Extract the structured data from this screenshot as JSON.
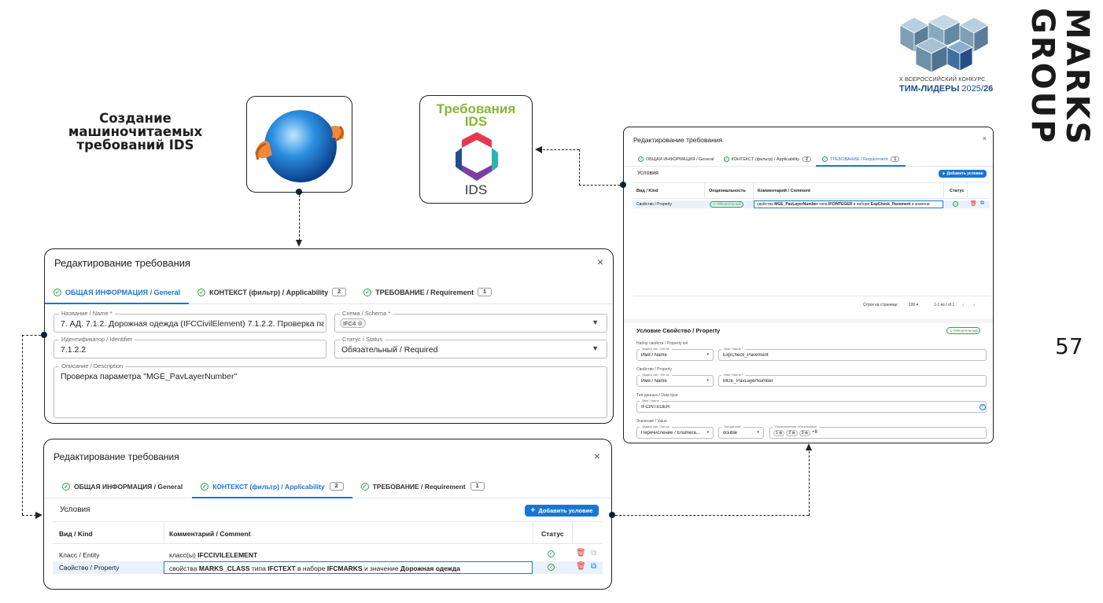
{
  "slide": {
    "title_lines": [
      "Создание",
      "машиночитаемых",
      "требований IDS"
    ],
    "brand": [
      "MARKS",
      "GROUP"
    ],
    "page_number": "57",
    "contest_line1": "X ВСЕРОССИЙСКИЙ КОНКУРС",
    "contest_line2": "ТИМ-ЛИДЕРЫ",
    "contest_year": "2025/",
    "contest_year2": "26",
    "ids_tile_title_1": "Требования",
    "ids_tile_title_2": "IDS",
    "ids_tile_label": "IDS"
  },
  "general_panel": {
    "title": "Редактирование требования",
    "close": "×",
    "tabs": [
      {
        "label": "ОБЩАЯ ИНФОРМАЦИЯ / General",
        "badge": ""
      },
      {
        "label": "КОНТЕКСТ (фильтр) / Applicability",
        "badge": "2"
      },
      {
        "label": "ТРЕБОВАНИЕ / Requirement",
        "badge": "1"
      }
    ],
    "name_label": "Название / Name *",
    "name_value": "7. АД. 7.1.2. Дорожная одежда (IFCCivilElement) 7.1.2.2. Проверка пара",
    "schema_label": "Схема / Schema *",
    "schema_chip": "IFC4",
    "id_label": "Идентификатор / Identifier",
    "id_value": "7.1.2.2",
    "status_label": "Статус / Status",
    "status_value": "Обязательный / Required",
    "desc_label": "Описание / Description",
    "desc_value": "Проверка параметра \"MGE_PavLayerNumber\""
  },
  "context_panel": {
    "title": "Редактирование требования",
    "close": "×",
    "tabs": [
      {
        "label": "ОБЩАЯ ИНФОРМАЦИЯ / General",
        "badge": ""
      },
      {
        "label": "КОНТЕКСТ (фильтр) / Applicability",
        "badge": "2"
      },
      {
        "label": "ТРЕБОВАНИЕ / Requirement",
        "badge": "1"
      }
    ],
    "section": "Условия",
    "add_button": "Добавить условие",
    "columns": [
      "Вид / Kind",
      "Комментарий / Comment",
      "Статус"
    ],
    "rows": [
      {
        "kind": "Класс / Entity",
        "c1": "класс(ы) ",
        "b1": "IFCCIVILELEMENT",
        "c2": "",
        "b2": "",
        "c3": "",
        "b3": "",
        "c4": "",
        "b4": ""
      },
      {
        "kind": "Свойство / Property",
        "c1": "свойства ",
        "b1": "MARKS_CLASS",
        "c2": " типа ",
        "b2": "IFCTEXT",
        "c3": " в наборе ",
        "b3": "IFCMARKS",
        "c4": " и значение ",
        "b4": "Дорожная одежда"
      }
    ]
  },
  "requirement_panel": {
    "title": "Редактирование требования",
    "close": "×",
    "tabs": [
      {
        "label": "ОБЩАЯ ИНФОРМАЦИЯ / General",
        "badge": ""
      },
      {
        "label": "КОНТЕКСТ (фильтр) / Applicability",
        "badge": "2"
      },
      {
        "label": "ТРЕБОВАНИЕ / Requirement",
        "badge": "1"
      }
    ],
    "section": "Условия",
    "add_button": "Добавить условие",
    "columns": [
      "Вид / Kind",
      "Опциональность",
      "Комментарий / Comment",
      "Статус"
    ],
    "row": {
      "kind": "Свойство / Property",
      "optionality": "Обязательный",
      "c1": "свойства ",
      "b1": "MGE_PavLayerNumber",
      "c2": " типа ",
      "b2": "IFCINTEGER",
      "c3": " в наборе ",
      "b3": "ExpCheck_Pavement",
      "c4": " и значени"
    },
    "pager_label": "Строк на странице:",
    "pager_size": "100",
    "pager_range": "1-1 из / of 1",
    "condition_title": "Условие Свойство / Property",
    "condition_badge": "Обязательный",
    "pset_title": "Набор свойств / Property set",
    "set_as_label": "Задать как / Set as",
    "set_as_value": "Имя / Name",
    "name_label": "Имя / Name *",
    "pset_value": "ExpCheck_Pavement",
    "prop_title": "Свойство / Property",
    "prop_value": "MGE_PavLayerNumber",
    "dtype_title": "Тип данных / Data type",
    "dtype_name_label": "Имя / Name",
    "dtype_value": "IFCINTEGER",
    "value_title": "Значение / Value",
    "value_set_as": "Перечисление / Enumera...",
    "value_type_label": "Тип данных",
    "value_type": "double",
    "enum_label": "Перечисление / Enumeration",
    "enum_chips": [
      "1",
      "2",
      "3"
    ],
    "enum_more": "+8"
  }
}
